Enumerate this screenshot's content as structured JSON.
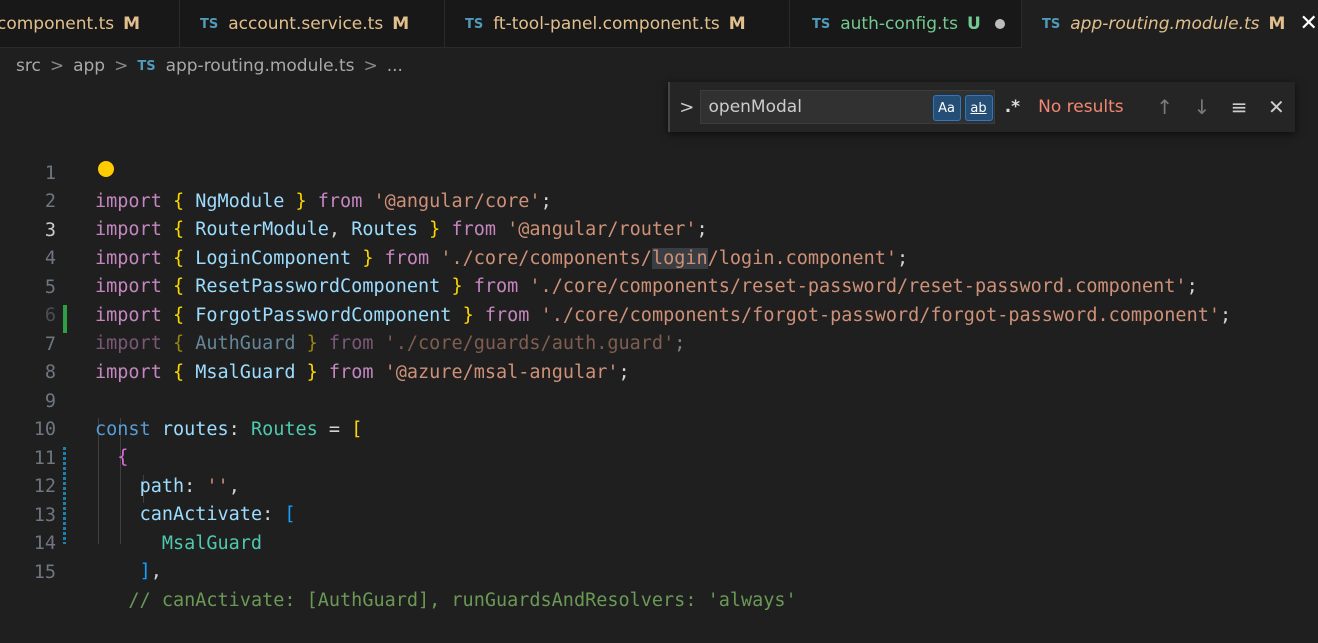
{
  "tabs": [
    {
      "name": "component.ts",
      "status": "M",
      "kind": "modified",
      "has_ts": false
    },
    {
      "name": "account.service.ts",
      "status": "M",
      "kind": "modified",
      "has_ts": true
    },
    {
      "name": "ft-tool-panel.component.ts",
      "status": "M",
      "kind": "modified",
      "has_ts": true
    },
    {
      "name": "auth-config.ts",
      "status": "U",
      "kind": "untracked",
      "has_ts": true
    },
    {
      "name": "app-routing.module.ts",
      "status": "M",
      "kind": "active",
      "has_ts": true
    }
  ],
  "ts_badge": "TS",
  "breadcrumb": {
    "parts": [
      "src",
      "app",
      "app-routing.module.ts",
      "..."
    ]
  },
  "find": {
    "query": "openModal",
    "match_case": "Aa",
    "whole_word": "ab",
    "regex": ".*",
    "result": "No results"
  },
  "line_numbers": [
    "1",
    "2",
    "3",
    "4",
    "5",
    "6",
    "7",
    "8",
    "9",
    "10",
    "11",
    "12",
    "13",
    "14",
    "15"
  ],
  "code": {
    "import": "import",
    "from": "from",
    "const": "const",
    "l1_id": "NgModule",
    "l1_str": "'@angular/core'",
    "l2_id1": "RouterModule",
    "l2_id2": "Routes",
    "l2_str": "'@angular/router'",
    "l3_id": "LoginComponent",
    "l3_str_a": "'./core/components/",
    "l3_str_hl": "login",
    "l3_str_b": "/login.component'",
    "l4_id": "ResetPasswordComponent",
    "l4_str": "'./core/components/reset-password/reset-password.component'",
    "l5_id": "ForgotPasswordComponent",
    "l5_str": "'./core/components/forgot-password/forgot-password.component'",
    "l6_id": "AuthGuard",
    "l6_str": "'./core/guards/auth.guard'",
    "l7_id": "MsalGuard",
    "l7_str": "'@azure/msal-angular'",
    "l9_var": "routes",
    "l9_type": "Routes",
    "l11_key": "path",
    "l11_val": "''",
    "l12_key": "canActivate",
    "l13_val": "MsalGuard",
    "l15_text": "// canActivate: [AuthGuard], runGuardsAndResolvers: 'always'"
  },
  "colors": {
    "accent": "#2b79c2",
    "modified": "#e2c08d",
    "untracked": "#73c991",
    "error": "#f48771",
    "added": "#2ea043"
  }
}
